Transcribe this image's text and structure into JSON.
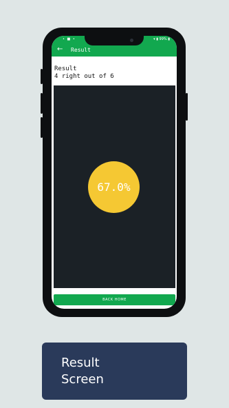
{
  "status_bar": {
    "left": "• ■ •",
    "right": "▾ ▮ 99% ▮"
  },
  "app_bar": {
    "back_icon": "arrow-left-icon",
    "title": "Result"
  },
  "result": {
    "heading": "Result",
    "summary": "4 right out of 6",
    "score": "67.0%"
  },
  "actions": {
    "back_home_label": "BACK HOME"
  },
  "caption": {
    "line1": "Result",
    "line2": "Screen"
  },
  "colors": {
    "accent_green": "#12a84f",
    "score_yellow": "#f5c833",
    "panel_dark": "#1b2126",
    "caption_bg": "#2a3a5a"
  }
}
